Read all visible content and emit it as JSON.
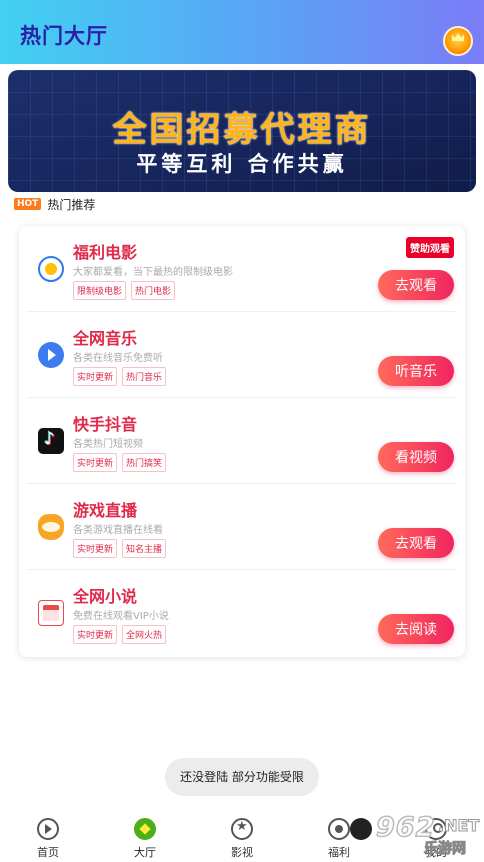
{
  "header": {
    "title": "热门大厅"
  },
  "banner": {
    "title": "全国招募代理商",
    "subtitle": "平等互利 合作共赢"
  },
  "section": {
    "badge": "HOT",
    "title": "热门推荐"
  },
  "rows": [
    {
      "title": "福利电影",
      "desc": "大家都爱看，当下最热的限制级电影",
      "tags": [
        "限制级电影",
        "热门电影"
      ],
      "button": "去观看",
      "sponsor": "赞助观看",
      "icon": "movie-icon"
    },
    {
      "title": "全网音乐",
      "desc": "各类在线音乐免费听",
      "tags": [
        "实时更新",
        "热门音乐"
      ],
      "button": "听音乐",
      "icon": "music-play-icon"
    },
    {
      "title": "快手抖音",
      "desc": "各类热门短视频",
      "tags": [
        "实时更新",
        "热门搞笑"
      ],
      "button": "看视频",
      "icon": "douyin-icon"
    },
    {
      "title": "游戏直播",
      "desc": "各类游戏直播在线看",
      "tags": [
        "实时更新",
        "知名主播"
      ],
      "button": "去观看",
      "icon": "game-mascot-icon"
    },
    {
      "title": "全网小说",
      "desc": "免费在线观看VIP小说",
      "tags": [
        "实时更新",
        "全网火热"
      ],
      "button": "去阅读",
      "icon": "novel-book-icon"
    }
  ],
  "toast": "还没登陆 部分功能受限",
  "tabs": [
    {
      "label": "首页",
      "icon": "home-play-icon"
    },
    {
      "label": "大厅",
      "icon": "hall-icon",
      "active": true
    },
    {
      "label": "影视",
      "icon": "video-star-icon"
    },
    {
      "label": "福利",
      "icon": "welfare-icon"
    },
    {
      "label": "我的",
      "icon": "mine-icon"
    }
  ],
  "watermark": {
    "number": "962",
    "suffix": ".NET",
    "text": "乐游网"
  },
  "colors": {
    "header_start": "#41d1f2",
    "header_end": "#7b7cf7",
    "accent": "#e02a4a",
    "button_start": "#ff6a5b",
    "button_end": "#f0255e",
    "hot": "#ff7a1a"
  }
}
